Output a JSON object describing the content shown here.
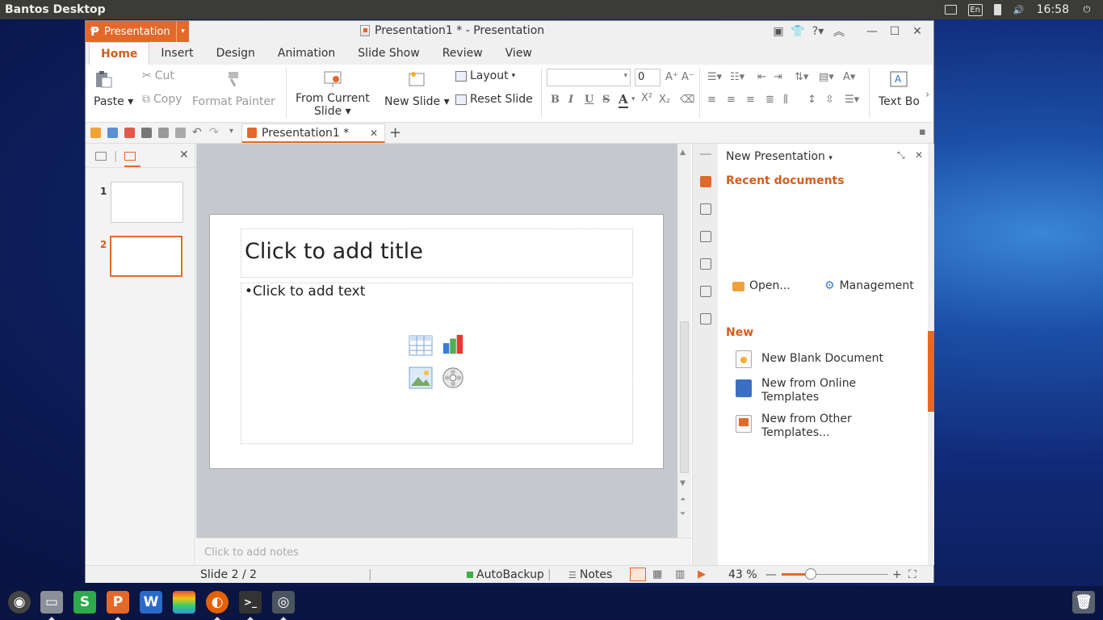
{
  "desktop": {
    "title": "Bantos Desktop",
    "tray": {
      "keyboard": "En",
      "clock": "16:58"
    }
  },
  "window": {
    "app_menu_label": "Presentation",
    "doc_title": "Presentation1 * - Presentation"
  },
  "tabs": [
    "Home",
    "Insert",
    "Design",
    "Animation",
    "Slide Show",
    "Review",
    "View"
  ],
  "ribbon": {
    "paste": "Paste",
    "cut": "Cut",
    "copy": "Copy",
    "format_painter": "Format Painter",
    "from_current_slide_1": "From Current",
    "from_current_slide_2": "Slide",
    "new_slide": "New Slide",
    "layout": "Layout",
    "reset_slide": "Reset Slide",
    "font_size": "0",
    "text_box": "Text Bo"
  },
  "doc_tab": {
    "label": "Presentation1 *"
  },
  "slides_panel": {
    "slides": [
      "1",
      "2"
    ],
    "selected_index": 2
  },
  "slide": {
    "title_placeholder": "Click to add title",
    "body_placeholder": "•Click to add text"
  },
  "notes_placeholder": "Click to add notes",
  "task_pane": {
    "title": "New Presentation",
    "recent_heading": "Recent documents",
    "open": "Open...",
    "management": "Management",
    "new_heading": "New",
    "items": [
      {
        "label_1": "New Blank Document",
        "label_2": ""
      },
      {
        "label_1": "New from Online",
        "label_2": "Templates"
      },
      {
        "label_1": "New from Other",
        "label_2": "Templates..."
      }
    ]
  },
  "status": {
    "slide_indicator": "Slide 2 / 2",
    "autobackup": "AutoBackup",
    "notes": "Notes",
    "zoom": "43 %",
    "zoom_fraction": 0.43
  },
  "colors": {
    "accent": "#e3692b",
    "dock": "#0a1542"
  },
  "dock_apps": [
    "launcher",
    "files",
    "spreadsheets",
    "presentation",
    "writer",
    "layers",
    "firefox",
    "terminal",
    "screenshot",
    "trash"
  ]
}
